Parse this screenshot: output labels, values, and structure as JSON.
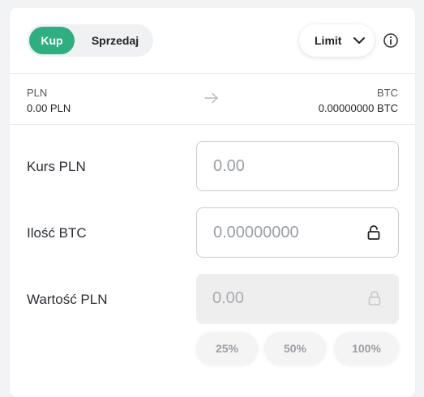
{
  "side_toggle": {
    "buy_label": "Kup",
    "sell_label": "Sprzedaj",
    "active": "Kup"
  },
  "order_type": {
    "selected": "Limit",
    "icon": "chevron-down-icon"
  },
  "info_icon": "info-icon",
  "currency_pair": {
    "from_code": "PLN",
    "from_balance": "0.00 PLN",
    "to_code": "BTC",
    "to_balance": "0.00000000 BTC",
    "arrow_icon": "arrow-right-icon"
  },
  "form": {
    "rate": {
      "label": "Kurs PLN",
      "placeholder": "0.00"
    },
    "amount": {
      "label": "Ilość BTC",
      "placeholder": "0.00000000",
      "icon": "unlock-icon"
    },
    "value": {
      "label": "Wartość PLN",
      "placeholder": "0.00",
      "icon": "lock-icon",
      "disabled": true
    }
  },
  "percent_buttons": [
    "25%",
    "50%",
    "100%"
  ],
  "colors": {
    "accent": "#2fae80",
    "border": "#c9cbcf",
    "disabled_bg": "#eeeeef"
  }
}
